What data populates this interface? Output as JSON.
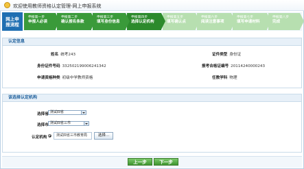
{
  "header": {
    "title": "欢迎使用教师资格认定管理-网上申报系统"
  },
  "steps": {
    "current_label_1": "网上申",
    "current_label_2": "报流程",
    "items": [
      {
        "top": "申报第一步",
        "bottom": "申报人必读"
      },
      {
        "top": "申报第二步",
        "bottom": "确认报名条款"
      },
      {
        "top": "申报第三步",
        "bottom": "填写身份信息"
      },
      {
        "top": "申报第四步",
        "bottom": "选择认定机构"
      },
      {
        "top": "申报第五步",
        "bottom": "填写确认点"
      },
      {
        "top": "申报第六步",
        "bottom": "阅读注意事项"
      },
      {
        "top": "申报第七步",
        "bottom": "填写申请材料"
      },
      {
        "top": "申报第八步",
        "bottom": "完成"
      }
    ]
  },
  "auth_info": {
    "title": "认定信息",
    "name_label": "姓名",
    "name_value": "统考243",
    "id_type_label": "证件类型",
    "id_type_value": "身份证",
    "id_no_label": "身份证件号码",
    "id_no_value": "332502199006241342",
    "exam_no_label": "报考合格证编号",
    "exam_no_value": "20114240000243",
    "cert_type_label": "申请资格种类",
    "cert_type_value": "初级中学教师资格",
    "subject_label": "任教学科",
    "subject_value": "物理"
  },
  "select_org": {
    "title": "该选择认定机构",
    "province_label": "选择省",
    "province_value": "测试四省",
    "city_label": "选择市",
    "city_value": "测试四省三市",
    "org_label": "认定机构",
    "org_value": "测试四省三市教育局",
    "choose_button": "选择..."
  },
  "footer": {
    "prev_button": "上一步",
    "next_button": "下一步"
  }
}
